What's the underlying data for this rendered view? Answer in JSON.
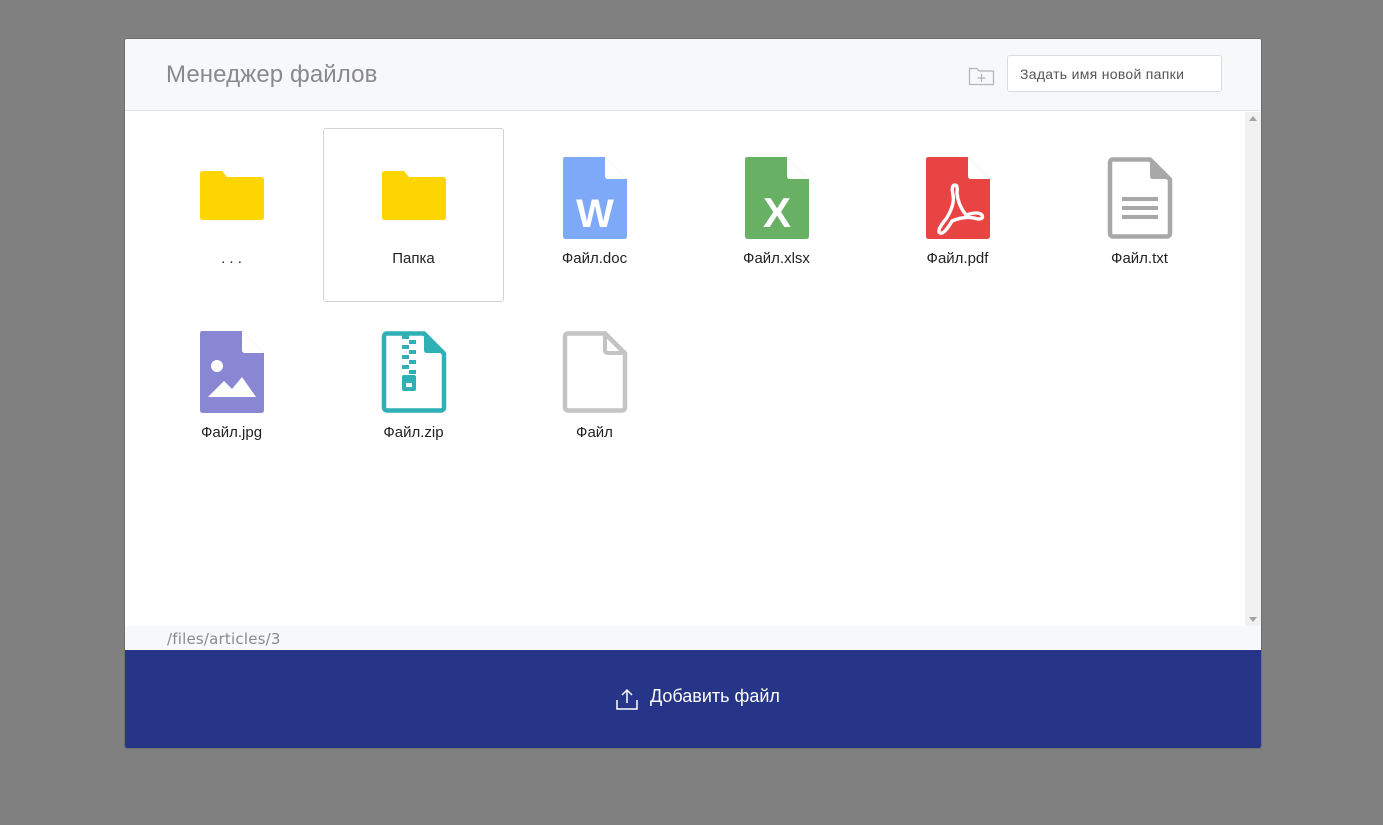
{
  "header": {
    "title": "Менеджер файлов",
    "new_folder_icon": "folder-plus-icon",
    "folder_input_placeholder": "Задать имя новой папки"
  },
  "items": [
    {
      "label": ". . .",
      "type": "folder",
      "icon": "folder-icon",
      "color": "#fed500",
      "selected": false
    },
    {
      "label": "Папка",
      "type": "folder",
      "icon": "folder-icon",
      "color": "#fed500",
      "selected": true
    },
    {
      "label": "Файл.doc",
      "type": "doc",
      "icon": "word-file-icon",
      "color": "#7ea9f8",
      "selected": false
    },
    {
      "label": "Файл.xlsx",
      "type": "xlsx",
      "icon": "excel-file-icon",
      "color": "#67b064",
      "selected": false
    },
    {
      "label": "Файл.pdf",
      "type": "pdf",
      "icon": "pdf-file-icon",
      "color": "#e84444",
      "selected": false
    },
    {
      "label": "Файл.txt",
      "type": "txt",
      "icon": "text-file-icon",
      "color": "#a8a8a8",
      "selected": false
    },
    {
      "label": "Файл.jpg",
      "type": "jpg",
      "icon": "image-file-icon",
      "color": "#8987d3",
      "selected": false
    },
    {
      "label": "Файл.zip",
      "type": "zip",
      "icon": "zip-file-icon",
      "color": "#2fb0b5",
      "selected": false
    },
    {
      "label": "Файл",
      "type": "blank",
      "icon": "blank-file-icon",
      "color": "#c4c4c4",
      "selected": false
    }
  ],
  "path": "/files/articles/3",
  "footer": {
    "upload_label": "Добавить файл",
    "upload_icon": "upload-icon"
  },
  "colors": {
    "backdrop": "#808080",
    "footer_bg": "#263588",
    "header_bg": "#f7f8fa"
  }
}
